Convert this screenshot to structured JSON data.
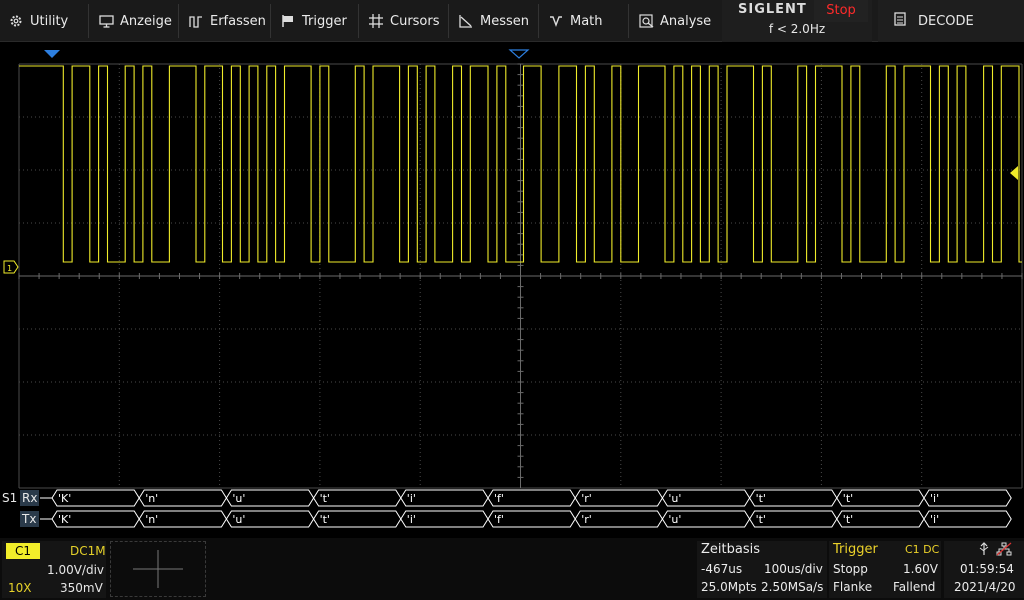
{
  "menu": [
    {
      "label": "Utility",
      "icon": "gear-icon"
    },
    {
      "label": "Anzeige",
      "icon": "monitor-icon"
    },
    {
      "label": "Erfassen",
      "icon": "acquire-icon"
    },
    {
      "label": "Trigger",
      "icon": "flag-icon"
    },
    {
      "label": "Cursors",
      "icon": "crosshair-icon"
    },
    {
      "label": "Messen",
      "icon": "measure-icon"
    },
    {
      "label": "Math",
      "icon": "math-icon"
    },
    {
      "label": "Analyse",
      "icon": "analysis-icon"
    }
  ],
  "brand": {
    "name": "SIGLENT",
    "run_state": "Stop",
    "trigger_freq": "f < 2.0Hz"
  },
  "decode_label": "DECODE",
  "serial": {
    "bus": "S1",
    "rx_label": "Rx",
    "tx_label": "Tx",
    "rx_values": [
      "'K'",
      "'n'",
      "'u'",
      "'t'",
      "'i'",
      "'f'",
      "'r'",
      "'u'",
      "'t'",
      "'t'",
      "'i'"
    ],
    "tx_values": [
      "'K'",
      "'n'",
      "'u'",
      "'t'",
      "'i'",
      "'f'",
      "'r'",
      "'u'",
      "'t'",
      "'t'",
      "'i'"
    ]
  },
  "channel": {
    "name": "C1",
    "coupling": "DC1M",
    "scale": "1.00V/div",
    "probe": "10X",
    "offset": "350mV"
  },
  "timebase": {
    "title": "Zeitbasis",
    "delay": "-467us",
    "scale": "100us/div",
    "memory": "25.0Mpts",
    "sample_rate": "2.50MSa/s"
  },
  "trigger": {
    "title": "Trigger",
    "source": "C1 DC",
    "mode": "Stopp",
    "level": "1.60V",
    "type": "Flanke",
    "slope": "Fallend"
  },
  "system": {
    "time": "01:59:54",
    "date": "2021/4/20",
    "usb_icon": "usb-icon",
    "network_icon": "network-icon"
  },
  "colors": {
    "trace": "#f0ec2a",
    "grid": "#5a5a5a",
    "bus": "#ffffff",
    "trigger_marker": "#2d7fe0"
  }
}
